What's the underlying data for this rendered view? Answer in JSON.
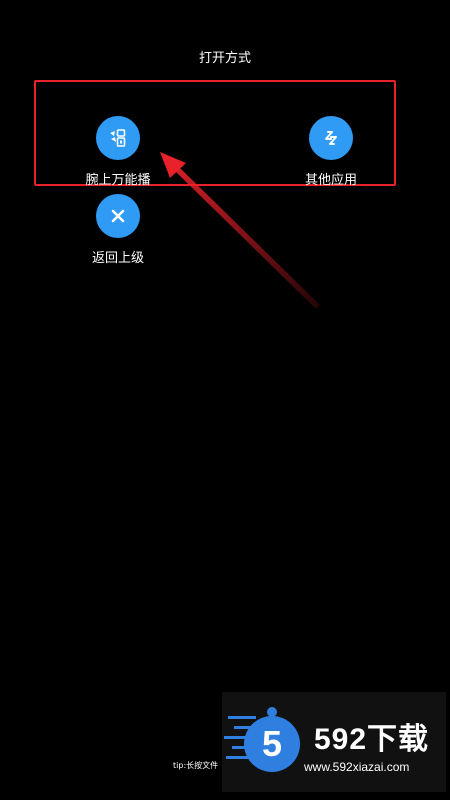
{
  "header": {
    "title": "打开方式"
  },
  "apps": [
    {
      "label": "腕上万能播",
      "icon": "grid-app-icon"
    },
    {
      "label": "其他应用",
      "icon": "link-app-icon"
    },
    {
      "label": "返回上级",
      "icon": "close-icon"
    }
  ],
  "footer": {
    "tip": "tip:长按文件"
  },
  "watermark": {
    "brand": "592下载",
    "url": "www.592xiazai.com"
  },
  "colors": {
    "accent": "#2f9bf4",
    "highlight": "#e8212a",
    "background": "#000000"
  }
}
